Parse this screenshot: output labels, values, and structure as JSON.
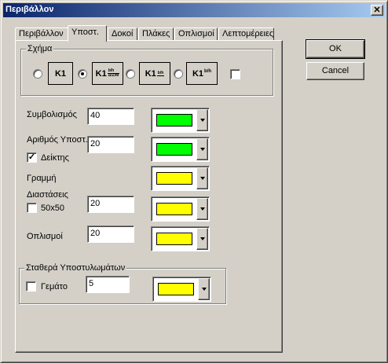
{
  "window": {
    "title": "Περιβάλλον",
    "close_glyph": "✕"
  },
  "tabs": [
    {
      "label": "Περιβάλλον"
    },
    {
      "label": "Υποστ."
    },
    {
      "label": "Δοκοί"
    },
    {
      "label": "Πλάκες"
    },
    {
      "label": "Οπλισμοί"
    },
    {
      "label": "Λεπτομέρειες"
    }
  ],
  "active_tab": "Υποστ.",
  "shape": {
    "label": "Σχήμα",
    "options": [
      {
        "text": "K1",
        "frac_top": "",
        "frac_bot": "",
        "selected": false
      },
      {
        "text": "K1",
        "frac_top": "b/h",
        "frac_bot": "Δ/Ζ/Μ",
        "selected": true
      },
      {
        "text": "K1",
        "frac_top": "b/h",
        "frac_bot": "",
        "selected": false
      },
      {
        "text": "K1",
        "frac_top": "b/h",
        "frac_bot": "",
        "selected": false
      }
    ],
    "extra_checked": false
  },
  "fields": {
    "symbolism": {
      "label": "Συμβολισμός",
      "value": "40",
      "color": "#00ff00"
    },
    "column_num": {
      "label": "Αριθμός Υποστ.",
      "value": "20",
      "color": "#00ff00"
    },
    "indicator": {
      "label": "Δείκτης",
      "checked": true
    },
    "line": {
      "label": "Γραμμή",
      "color": "#ffff00"
    },
    "dimensions": {
      "label": "Διαστάσεις",
      "value": "20",
      "color": "#ffff00"
    },
    "fifty": {
      "label": "50x50",
      "checked": false
    },
    "rebar": {
      "label": "Οπλισμοί",
      "value": "20",
      "color": "#ffff00"
    }
  },
  "constant": {
    "label": "Σταθερά Υποστυλωμάτων",
    "filled_label": "Γεμάτο",
    "filled_checked": false,
    "value": "5",
    "color": "#ffff00"
  },
  "buttons": {
    "ok": "OK",
    "cancel": "Cancel"
  }
}
